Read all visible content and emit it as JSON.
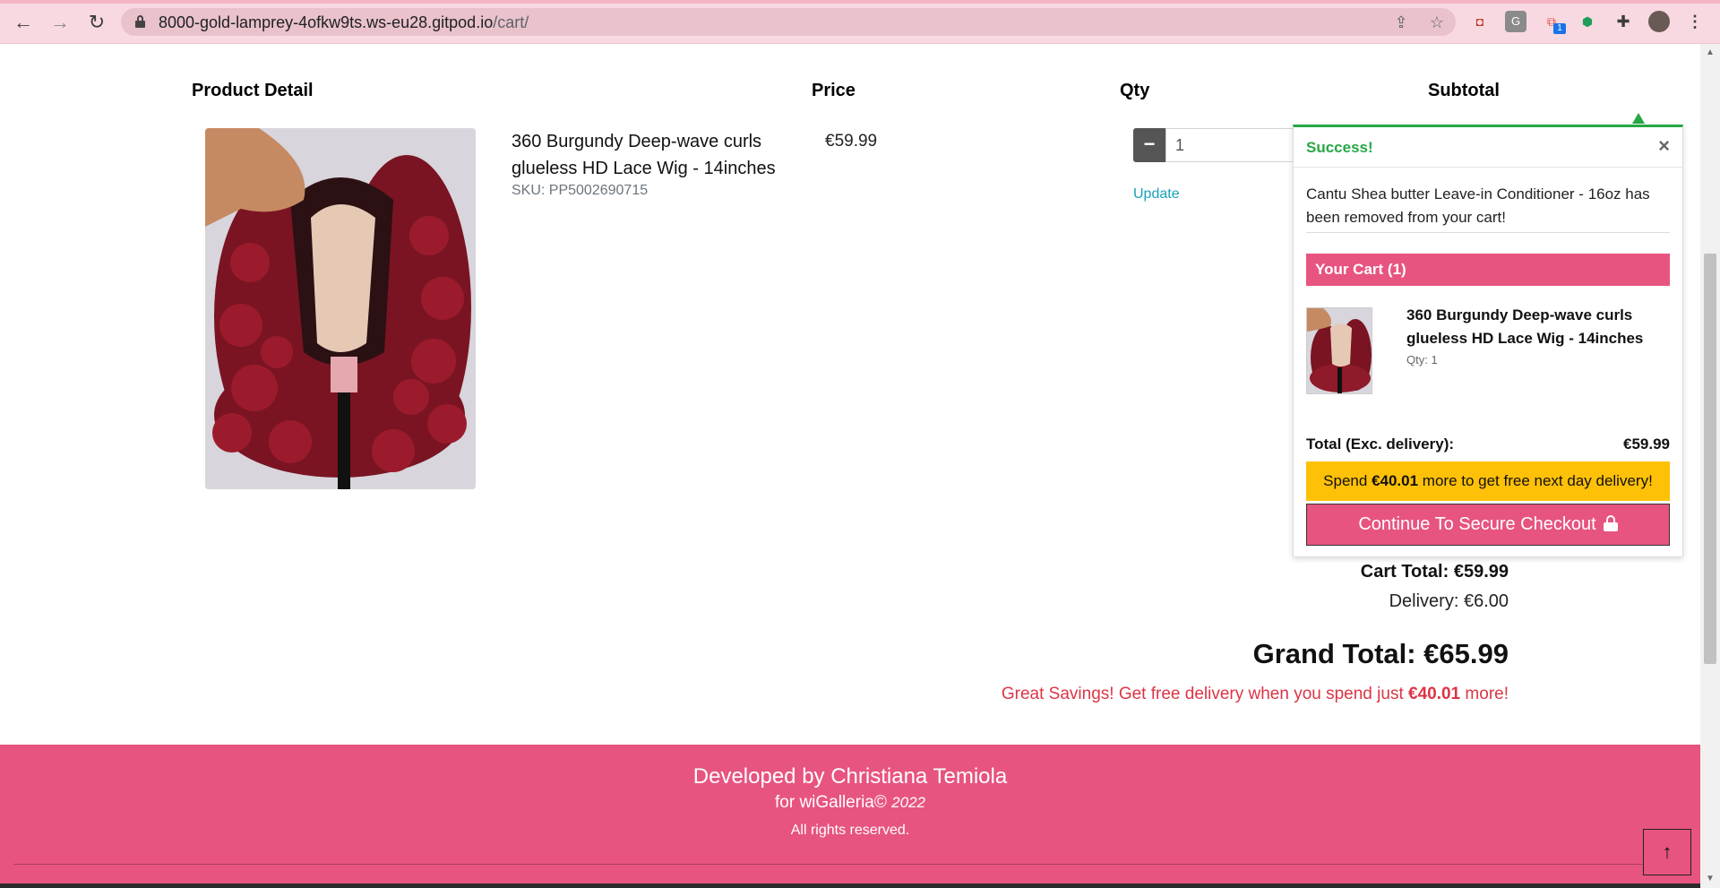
{
  "browser": {
    "url_host": "8000-gold-lamprey-4ofkw9ts.ws-eu28.gitpod.io",
    "url_path": "/cart/",
    "icons": [
      "back-icon",
      "forward-icon",
      "reload-icon",
      "lock-icon",
      "share-icon",
      "star-icon",
      "extensions-icon",
      "menu-icon"
    ],
    "extension_badge": "1"
  },
  "cart": {
    "headers": {
      "product": "Product Detail",
      "price": "Price",
      "qty": "Qty",
      "subtotal": "Subtotal"
    },
    "item": {
      "name": "360 Burgundy Deep-wave curls glueless HD Lace Wig - 14inches",
      "sku": "SKU: PP5002690715",
      "price": "€59.99",
      "qty_value": "1",
      "update_label": "Update"
    },
    "cart_total": "Cart Total: €59.99",
    "delivery": "Delivery: €6.00",
    "grand_total": "Grand Total: €65.99",
    "savings_prefix": "Great Savings! Get free delivery when you spend just ",
    "savings_amount": "€40.01",
    "savings_suffix": " more!"
  },
  "popup": {
    "title": "Success!",
    "close": "×",
    "message": "Cantu Shea butter Leave-in Conditioner - 16oz has been removed from your cart!",
    "cart_heading": "Your Cart (1)",
    "item_name": "360 Burgundy Deep-wave curls glueless HD Lace Wig - 14inches",
    "item_qty": "Qty: 1",
    "total_label": "Total (Exc. delivery):",
    "total_value": "€59.99",
    "spend_prefix": "Spend ",
    "spend_amount": "€40.01",
    "spend_suffix": " more to get free next day delivery!",
    "checkout_label": "Continue To Secure Checkout",
    "success_color": "#28a745"
  },
  "footer": {
    "developed_by": "Developed by Christiana Temiola",
    "for_prefix": "for wiGalleria© ",
    "year": "2022",
    "rights": "All rights reserved.",
    "to_top_icon": "arrow-up-icon",
    "brand_color": "#e75480"
  }
}
